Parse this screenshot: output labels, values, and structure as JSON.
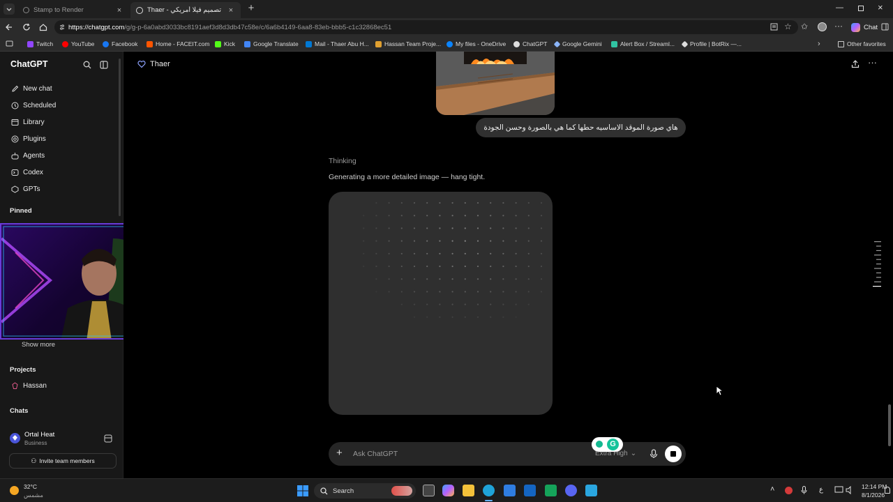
{
  "browser": {
    "tabs": [
      {
        "title": "Stamp to Render",
        "active": false
      },
      {
        "title": "Thaer - تصميم فيلا أمريكي",
        "active": true
      }
    ],
    "new_tab_symbol": "+",
    "url_host": "https://chatgpt.com",
    "url_path": "/g/g-p-6a0abd3033bc8191aef3d8d3db47c58e/c/6a6b4149-6aa8-83eb-bbb5-c1c32868ec51",
    "copilot_label": "Chat",
    "bookmarks": [
      {
        "label": "Twitch",
        "color": "#9146ff"
      },
      {
        "label": "YouTube",
        "color": "#ff0000"
      },
      {
        "label": "Facebook",
        "color": "#1877f2"
      },
      {
        "label": "Home - FACEIT.com",
        "color": "#ff5500"
      },
      {
        "label": "Kick",
        "color": "#53fc18"
      },
      {
        "label": "Google Translate",
        "color": "#4285f4"
      },
      {
        "label": "Mail - Thaer Abu H...",
        "color": "#0078d4"
      },
      {
        "label": "Hassan Team Proje...",
        "color": "#e0a030"
      },
      {
        "label": "My files - OneDrive",
        "color": "#0a84ff"
      },
      {
        "label": "ChatGPT",
        "color": "#dddddd"
      },
      {
        "label": "Google Gemini",
        "color": "#8ab4f8"
      },
      {
        "label": "Alert Box / Streaml...",
        "color": "#31c3a2"
      },
      {
        "label": "Profile | BotRix —...",
        "color": "#dddddd"
      }
    ],
    "other_favorites": "Other favorites"
  },
  "sidebar": {
    "brand": "ChatGPT",
    "nav": [
      {
        "label": "New chat",
        "icon": "edit-icon"
      },
      {
        "label": "Scheduled",
        "icon": "clock-icon"
      },
      {
        "label": "Library",
        "icon": "library-icon"
      },
      {
        "label": "Plugins",
        "icon": "plugin-icon"
      },
      {
        "label": "Agents",
        "icon": "agents-icon"
      },
      {
        "label": "Codex",
        "icon": "codex-icon"
      },
      {
        "label": "GPTs",
        "icon": "gpts-icon"
      }
    ],
    "pinned_title": "Pinned",
    "show_more": "Show more",
    "projects_title": "Projects",
    "project_name": "Hassan",
    "chats_title": "Chats",
    "account_name": "Ortal Heat",
    "account_plan": "Business",
    "invite_label": "Invite team members"
  },
  "chat": {
    "header_title": "Thaer",
    "user_message": "هاي صورة الموقد الاساسيه حطها كما هي بالصورة وحسن الجودة",
    "thinking_label": "Thinking",
    "status_text": "Generating a more detailed image — hang tight.",
    "composer_placeholder": "Ask ChatGPT",
    "model_label": "Extra High",
    "chevron": "⌄"
  },
  "taskbar": {
    "temperature": "32°C",
    "weather_text": "مشمس",
    "search_label": "Search",
    "lang": "ع",
    "time": "12:14 PM",
    "date": "8/1/2026"
  }
}
